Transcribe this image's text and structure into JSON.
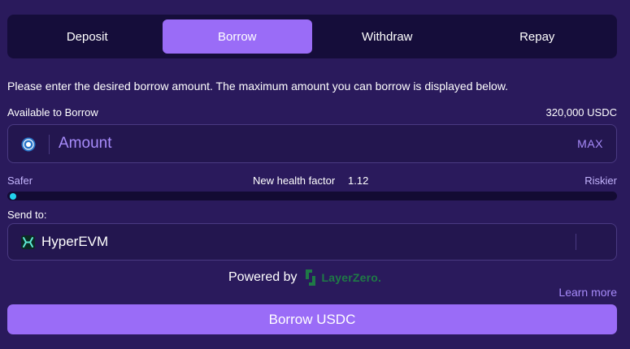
{
  "tabs": [
    {
      "label": "Deposit",
      "active": false
    },
    {
      "label": "Borrow",
      "active": true
    },
    {
      "label": "Withdraw",
      "active": false
    },
    {
      "label": "Repay",
      "active": false
    }
  ],
  "intro_text": "Please enter the desired borrow amount. The maximum amount you can borrow is displayed below.",
  "available": {
    "label": "Available to Borrow",
    "value": "320,000 USDC"
  },
  "amount": {
    "placeholder": "Amount",
    "max_label": "MAX",
    "icon": "usdc-coin-icon"
  },
  "health": {
    "safer_label": "Safer",
    "riskier_label": "Riskier",
    "label": "New health factor",
    "value": "1.12",
    "indicator_position": 0.0
  },
  "send_to": {
    "label": "Send to:",
    "chain": "HyperEVM",
    "icon": "hyperevm-icon"
  },
  "powered": {
    "label": "Powered by",
    "brand": "LayerZero."
  },
  "learn_more": "Learn more",
  "submit_label": "Borrow USDC",
  "colors": {
    "background": "#2a1a5c",
    "panel": "#150d3a",
    "accent": "#9a6cf7",
    "muted_accent": "#a78bfa",
    "health_indicator": "#22d3ee",
    "layerzero_green": "#1f7a46"
  }
}
